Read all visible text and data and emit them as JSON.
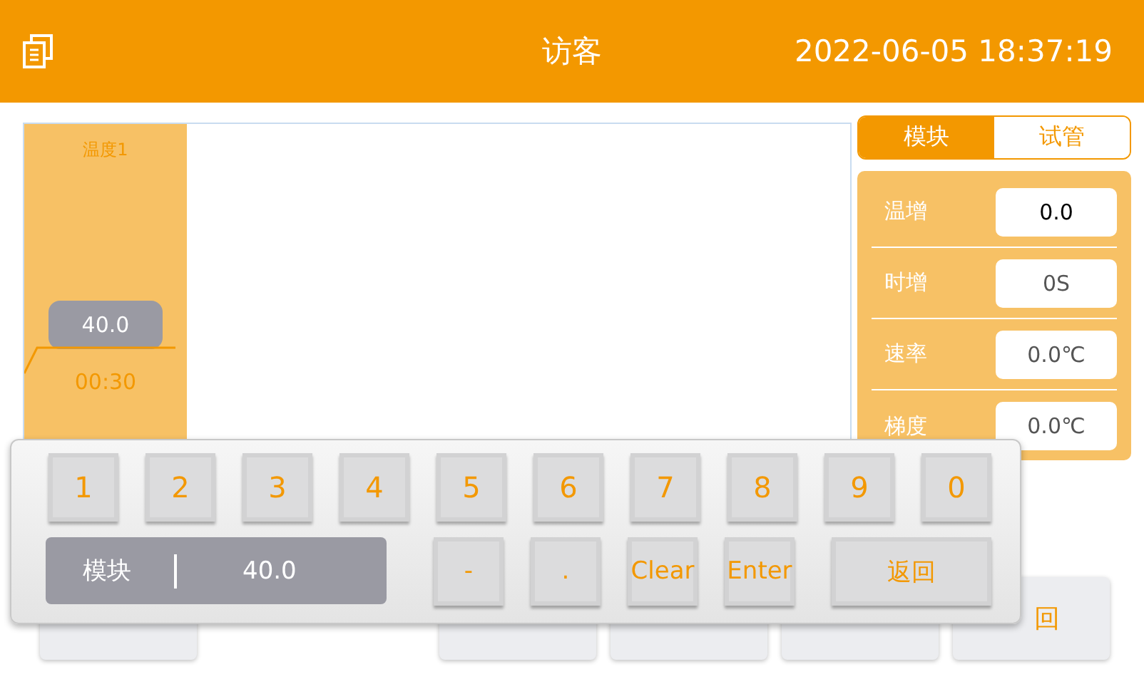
{
  "header": {
    "title": "访客",
    "datetime": "2022-06-05 18:37:19"
  },
  "program": {
    "steps": [
      {
        "label": "温度1",
        "temperature": "40.0",
        "time": "00:30"
      }
    ]
  },
  "tabs": [
    {
      "label": "模块",
      "selected": true
    },
    {
      "label": "试管",
      "selected": false
    }
  ],
  "params": [
    {
      "label": "温增",
      "value": "0.0",
      "highlighted": true
    },
    {
      "label": "时增",
      "value": "0S",
      "highlighted": false
    },
    {
      "label": "速率",
      "value": "0.0℃",
      "highlighted": false
    },
    {
      "label": "梯度",
      "value": "0.0℃",
      "highlighted": false
    }
  ],
  "bottom_buttons": [
    {
      "kind": "button"
    },
    {
      "kind": "button"
    },
    {
      "kind": "button"
    },
    {
      "kind": "button"
    },
    {
      "kind": "button",
      "label": "回"
    }
  ],
  "keypad": {
    "digit_keys": [
      "1",
      "2",
      "3",
      "4",
      "5",
      "6",
      "7",
      "8",
      "9",
      "0"
    ],
    "function_keys": [
      "-",
      ".",
      "Clear",
      "Enter",
      "返回"
    ],
    "display": {
      "label": "模块",
      "value": "40.0"
    }
  }
}
